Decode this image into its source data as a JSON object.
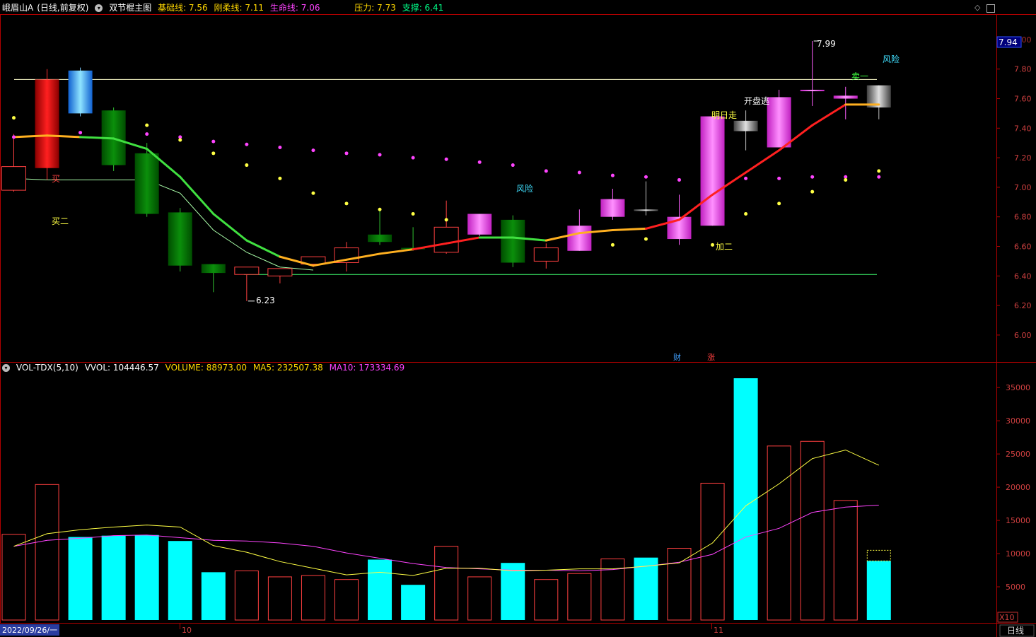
{
  "header": {
    "stock_name": "峨眉山A",
    "period_label": "(日线,前复权)",
    "indicator_name": "双节棍主图",
    "base_line_label": "基础线: 7.56",
    "rigid_line_label": "刚柔线: 7.11",
    "life_line_label": "生命线: 7.06",
    "pressure_label": "压力: 7.73",
    "support_label": "支撑: 6.41"
  },
  "volume_header": {
    "name": "VOL-TDX(5,10)",
    "vvol_label": "VVOL: 104446.57",
    "volume_label": "VOLUME: 88973.00",
    "ma5_label": "MA5: 232507.38",
    "ma10_label": "MA10: 173334.69"
  },
  "price_axis": {
    "current_price": "7.94",
    "ticks": [
      "7.80",
      "7.60",
      "7.40",
      "7.20",
      "7.00",
      "6.80",
      "6.60",
      "6.40",
      "6.20",
      "6.00"
    ],
    "top_tick": "8.00"
  },
  "volume_axis": {
    "ticks": [
      "35000",
      "30000",
      "25000",
      "20000",
      "15000",
      "10000",
      "5000"
    ],
    "multiplier": "X10"
  },
  "time_axis": {
    "start_date": "2022/09/26/一",
    "month_10": "10",
    "month_11": "11",
    "period_button": "日线"
  },
  "annotations": {
    "high_price": "7.99",
    "low_price": "6.23",
    "buy": "买",
    "buy2": "买二",
    "risk1": "风险",
    "risk2": "风险",
    "add2": "加二",
    "tomorrow_go": "明日走",
    "open_escape": "开盘逃",
    "sell1": "卖一",
    "finance_marker": "财",
    "limit_up_marker": "涨"
  },
  "colors": {
    "up_red": "#ff3b3b",
    "down_green": "#00c000",
    "magenta": "#ff44ff",
    "cyan": "#00ffff",
    "yellow": "#ffff44",
    "axis_red": "#b00000"
  },
  "chart_data": {
    "type": "candlestick",
    "candles": [
      {
        "open": 6.98,
        "high": 7.36,
        "low": 6.97,
        "close": 7.14,
        "style": "up"
      },
      {
        "open": 7.13,
        "high": 7.8,
        "low": 7.05,
        "close": 7.73,
        "style": "red"
      },
      {
        "open": 7.5,
        "high": 7.81,
        "low": 7.48,
        "close": 7.79,
        "style": "blue"
      },
      {
        "open": 7.52,
        "high": 7.54,
        "low": 7.11,
        "close": 7.15,
        "style": "green"
      },
      {
        "open": 7.23,
        "high": 7.3,
        "low": 6.8,
        "close": 6.82,
        "style": "green"
      },
      {
        "open": 6.83,
        "high": 6.86,
        "low": 6.43,
        "close": 6.47,
        "style": "green"
      },
      {
        "open": 6.48,
        "high": 6.48,
        "low": 6.29,
        "close": 6.42,
        "style": "green"
      },
      {
        "open": 6.41,
        "high": 6.46,
        "low": 6.23,
        "close": 6.46,
        "style": "up"
      },
      {
        "open": 6.4,
        "high": 6.45,
        "low": 6.35,
        "close": 6.45,
        "style": "up"
      },
      {
        "open": 6.48,
        "high": 6.52,
        "low": 6.46,
        "close": 6.53,
        "style": "up"
      },
      {
        "open": 6.49,
        "high": 6.63,
        "low": 6.43,
        "close": 6.59,
        "style": "up"
      },
      {
        "open": 6.68,
        "high": 6.85,
        "low": 6.61,
        "close": 6.63,
        "style": "green"
      },
      {
        "open": 6.59,
        "high": 6.73,
        "low": 6.57,
        "close": 6.58,
        "style": "green"
      },
      {
        "open": 6.56,
        "high": 6.91,
        "low": 6.55,
        "close": 6.73,
        "style": "up"
      },
      {
        "open": 6.68,
        "high": 6.82,
        "low": 6.67,
        "close": 6.82,
        "style": "magenta"
      },
      {
        "open": 6.78,
        "high": 6.81,
        "low": 6.46,
        "close": 6.49,
        "style": "green"
      },
      {
        "open": 6.5,
        "high": 6.62,
        "low": 6.45,
        "close": 6.59,
        "style": "up"
      },
      {
        "open": 6.57,
        "high": 6.85,
        "low": 6.57,
        "close": 6.74,
        "style": "magenta"
      },
      {
        "open": 6.8,
        "high": 6.99,
        "low": 6.78,
        "close": 6.92,
        "style": "magenta"
      },
      {
        "open": 6.84,
        "high": 7.04,
        "low": 6.81,
        "close": 6.85,
        "style": "gray"
      },
      {
        "open": 6.65,
        "high": 6.95,
        "low": 6.61,
        "close": 6.8,
        "style": "magenta"
      },
      {
        "open": 6.74,
        "high": 7.48,
        "low": 6.74,
        "close": 7.48,
        "style": "magenta"
      },
      {
        "open": 7.45,
        "high": 7.52,
        "low": 7.25,
        "close": 7.38,
        "style": "gray"
      },
      {
        "open": 7.27,
        "high": 7.66,
        "low": 7.27,
        "close": 7.61,
        "style": "magenta"
      },
      {
        "open": 7.65,
        "high": 7.99,
        "low": 7.55,
        "close": 7.66,
        "style": "magenta"
      },
      {
        "open": 7.6,
        "high": 7.68,
        "low": 7.46,
        "close": 7.62,
        "style": "magenta"
      },
      {
        "open": 7.54,
        "high": 7.69,
        "low": 7.46,
        "close": 7.69,
        "style": "gray"
      }
    ],
    "volume_x10": [
      12900,
      20400,
      12500,
      12700,
      12800,
      11900,
      7200,
      7400,
      6500,
      6700,
      6100,
      9100,
      5300,
      11100,
      6500,
      8600,
      6100,
      7000,
      9200,
      9400,
      10800,
      20600,
      36400,
      26200,
      26900,
      18000,
      8900
    ],
    "volume_style": [
      "hollow",
      "hollow",
      "fill",
      "fill",
      "fill",
      "fill",
      "fill",
      "hollow",
      "hollow",
      "hollow",
      "hollow",
      "fill",
      "fill",
      "hollow",
      "hollow",
      "fill",
      "hollow",
      "hollow",
      "hollow",
      "fill",
      "hollow",
      "hollow",
      "fill",
      "hollow",
      "hollow",
      "hollow",
      "fill"
    ],
    "vol_ma5": [
      11100,
      13000,
      13600,
      14000,
      14300,
      14000,
      11200,
      10200,
      8800,
      7800,
      6800,
      7200,
      6700,
      7800,
      7800,
      7400,
      7500,
      7700,
      7700,
      8100,
      8600,
      11600,
      17200,
      20500,
      24300,
      25600,
      23300
    ],
    "vol_ma10": [
      11100,
      12000,
      12300,
      12700,
      12800,
      12400,
      12000,
      11900,
      11600,
      11100,
      10100,
      9300,
      8500,
      7900,
      7700,
      7500,
      7500,
      7400,
      7600,
      8100,
      8700,
      9900,
      12500,
      13800,
      16200,
      17000,
      17300
    ],
    "base_line": [
      7.34,
      7.35,
      7.34,
      7.33,
      7.26,
      7.07,
      6.82,
      6.64,
      6.53,
      6.47,
      6.51,
      6.55,
      6.58,
      6.62,
      6.66,
      6.66,
      6.64,
      6.69,
      6.71,
      6.72,
      6.78,
      6.95,
      7.1,
      7.25,
      7.42,
      7.56,
      7.56
    ],
    "base_line_colors": [
      "yellow",
      "yellow",
      "yellow",
      "green",
      "green",
      "green",
      "green",
      "green",
      "green",
      "yellow",
      "yellow",
      "yellow",
      "yellow",
      "red",
      "red",
      "green",
      "green",
      "yellow",
      "yellow",
      "yellow",
      "red",
      "red",
      "red",
      "red",
      "red",
      "red",
      "yellow"
    ],
    "life_line": [
      7.06,
      7.05,
      7.05,
      7.05,
      7.05,
      6.96,
      6.71,
      6.56,
      6.46,
      6.44
    ],
    "resistance": 7.73,
    "support": 6.41,
    "magenta_dots": [
      {
        "i": 0,
        "v": 7.34
      },
      {
        "i": 2,
        "v": 7.37
      },
      {
        "i": 4,
        "v": 7.36
      },
      {
        "i": 5,
        "v": 7.34
      },
      {
        "i": 6,
        "v": 7.31
      },
      {
        "i": 7,
        "v": 7.29
      },
      {
        "i": 8,
        "v": 7.27
      },
      {
        "i": 9,
        "v": 7.25
      },
      {
        "i": 10,
        "v": 7.23
      },
      {
        "i": 11,
        "v": 7.22
      },
      {
        "i": 12,
        "v": 7.2
      },
      {
        "i": 13,
        "v": 7.19
      },
      {
        "i": 14,
        "v": 7.17
      },
      {
        "i": 15,
        "v": 7.15
      },
      {
        "i": 16,
        "v": 7.11
      },
      {
        "i": 17,
        "v": 7.1
      },
      {
        "i": 18,
        "v": 7.08
      },
      {
        "i": 19,
        "v": 7.07
      },
      {
        "i": 20,
        "v": 7.05
      },
      {
        "i": 22,
        "v": 7.06
      },
      {
        "i": 23,
        "v": 7.06
      },
      {
        "i": 24,
        "v": 7.07
      },
      {
        "i": 25,
        "v": 7.07
      },
      {
        "i": 26,
        "v": 7.07
      }
    ],
    "yellow_dots": [
      {
        "i": 0,
        "v": 7.47
      },
      {
        "i": 4,
        "v": 7.42
      },
      {
        "i": 5,
        "v": 7.32
      },
      {
        "i": 6,
        "v": 7.23
      },
      {
        "i": 7,
        "v": 7.15
      },
      {
        "i": 8,
        "v": 7.06
      },
      {
        "i": 9,
        "v": 6.96
      },
      {
        "i": 10,
        "v": 6.89
      },
      {
        "i": 11,
        "v": 6.85
      },
      {
        "i": 12,
        "v": 6.82
      },
      {
        "i": 13,
        "v": 6.78
      },
      {
        "i": 18,
        "v": 6.61
      },
      {
        "i": 19,
        "v": 6.65
      },
      {
        "i": 21,
        "v": 6.61
      },
      {
        "i": 22,
        "v": 6.82
      },
      {
        "i": 23,
        "v": 6.89
      },
      {
        "i": 24,
        "v": 6.97
      },
      {
        "i": 25,
        "v": 7.05
      },
      {
        "i": 26,
        "v": 7.11
      }
    ],
    "ylim_price": [
      5.9,
      8.05
    ],
    "ylim_volume_x10": [
      0,
      36400
    ]
  }
}
